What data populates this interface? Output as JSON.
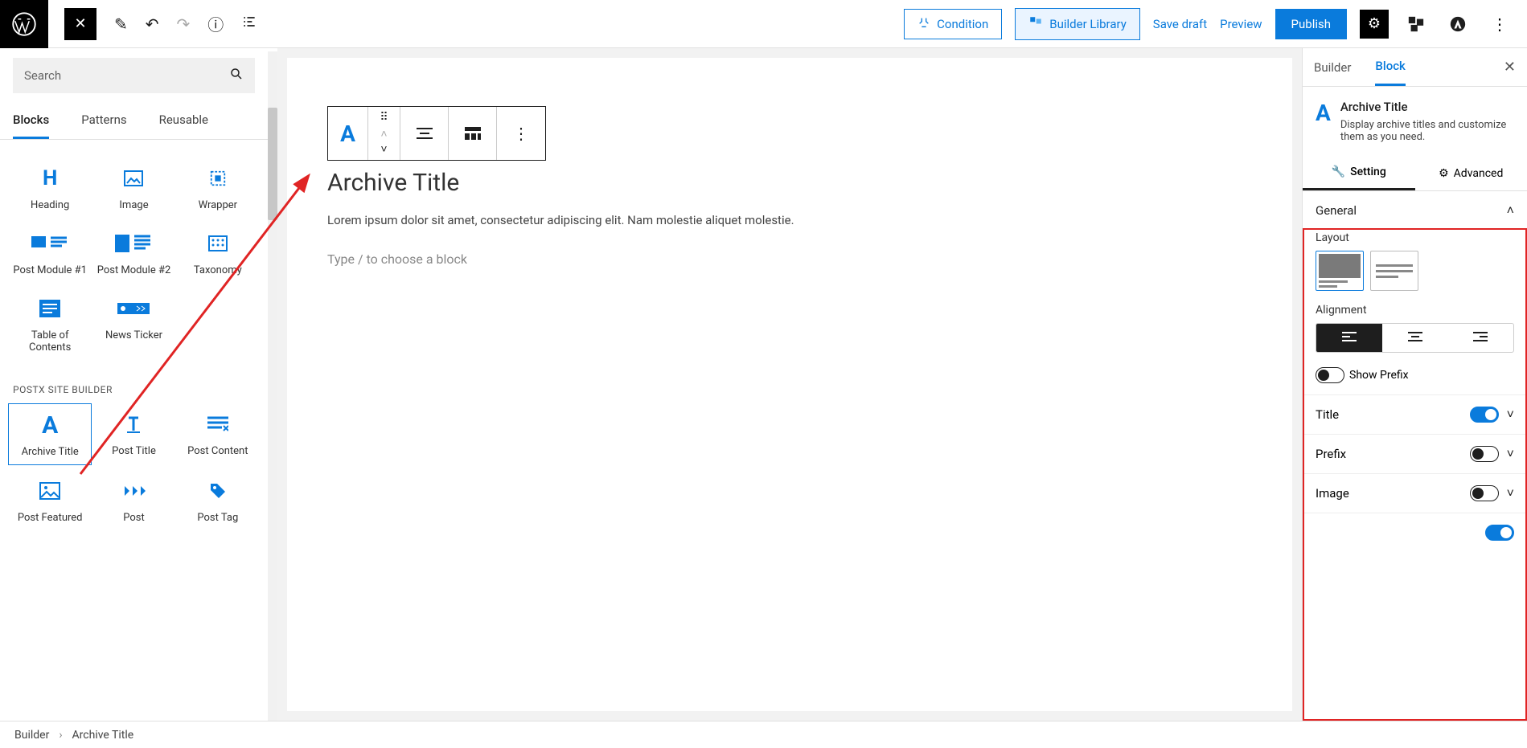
{
  "topbar": {
    "condition": "Condition",
    "builder_library": "Builder Library",
    "save_draft": "Save draft",
    "preview": "Preview",
    "publish": "Publish"
  },
  "left": {
    "search_placeholder": "Search",
    "tabs": {
      "blocks": "Blocks",
      "patterns": "Patterns",
      "reusable": "Reusable"
    },
    "category": "POSTX SITE BUILDER",
    "items": {
      "heading": "Heading",
      "image": "Image",
      "wrapper": "Wrapper",
      "pm1": "Post Module #1",
      "pm2": "Post Module #2",
      "taxonomy": "Taxonomy",
      "toc": "Table of Contents",
      "newsticker": "News Ticker",
      "archive_title": "Archive Title",
      "post_title": "Post Title",
      "post_content": "Post Content",
      "post_featured": "Post Featured",
      "post": "Post",
      "post_tag": "Post Tag"
    }
  },
  "canvas": {
    "heading": "Archive Title",
    "lorem": "Lorem ipsum dolor sit amet, consectetur adipiscing elit. Nam molestie aliquet molestie.",
    "placeholder": "Type / to choose a block"
  },
  "right": {
    "tabs": {
      "builder": "Builder",
      "block": "Block"
    },
    "block_title": "Archive Title",
    "block_desc": "Display archive titles and customize them as you need.",
    "subtabs": {
      "setting": "Setting",
      "advanced": "Advanced"
    },
    "general": "General",
    "layout_label": "Layout",
    "alignment_label": "Alignment",
    "show_prefix": "Show Prefix",
    "rows": {
      "title": "Title",
      "prefix": "Prefix",
      "image": "Image"
    }
  },
  "footer": {
    "crumb1": "Builder",
    "crumb2": "Archive Title"
  }
}
